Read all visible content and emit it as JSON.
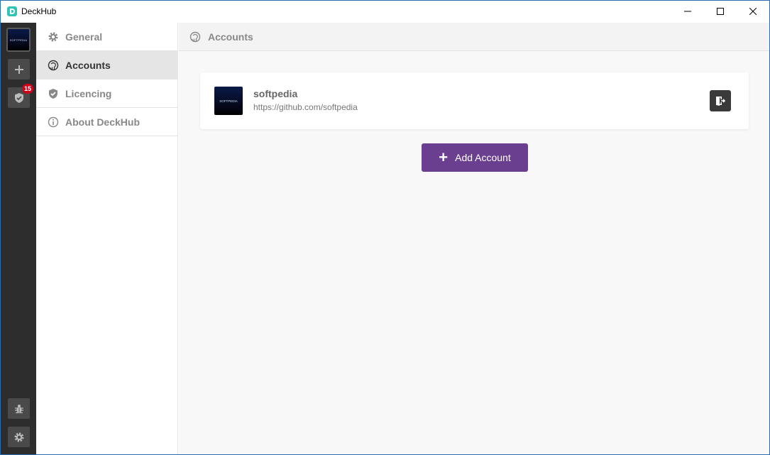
{
  "window": {
    "title": "DeckHub"
  },
  "rail": {
    "avatar_text": "SOFTPEDIA",
    "badge_count": "15",
    "icons": [
      "avatar",
      "plus-icon",
      "check-shield-icon",
      "bug-icon",
      "gear-icon"
    ]
  },
  "nav": {
    "items": [
      {
        "label": "General",
        "icon": "gear-icon"
      },
      {
        "label": "Accounts",
        "icon": "github-icon",
        "active": true
      },
      {
        "label": "Licencing",
        "icon": "check-shield-icon"
      },
      {
        "label": "About DeckHub",
        "icon": "info-icon"
      }
    ]
  },
  "main": {
    "header_title": "Accounts",
    "accounts": [
      {
        "avatar_text": "SOFTPEDIA",
        "name": "softpedia",
        "url": "https://github.com/softpedia"
      }
    ],
    "add_button_label": "Add Account"
  },
  "colors": {
    "rail_bg": "#2d2d2d",
    "accent_purple": "#6b3f8f",
    "badge_red": "#d0021b",
    "logo_teal": "#2ec4b6"
  }
}
